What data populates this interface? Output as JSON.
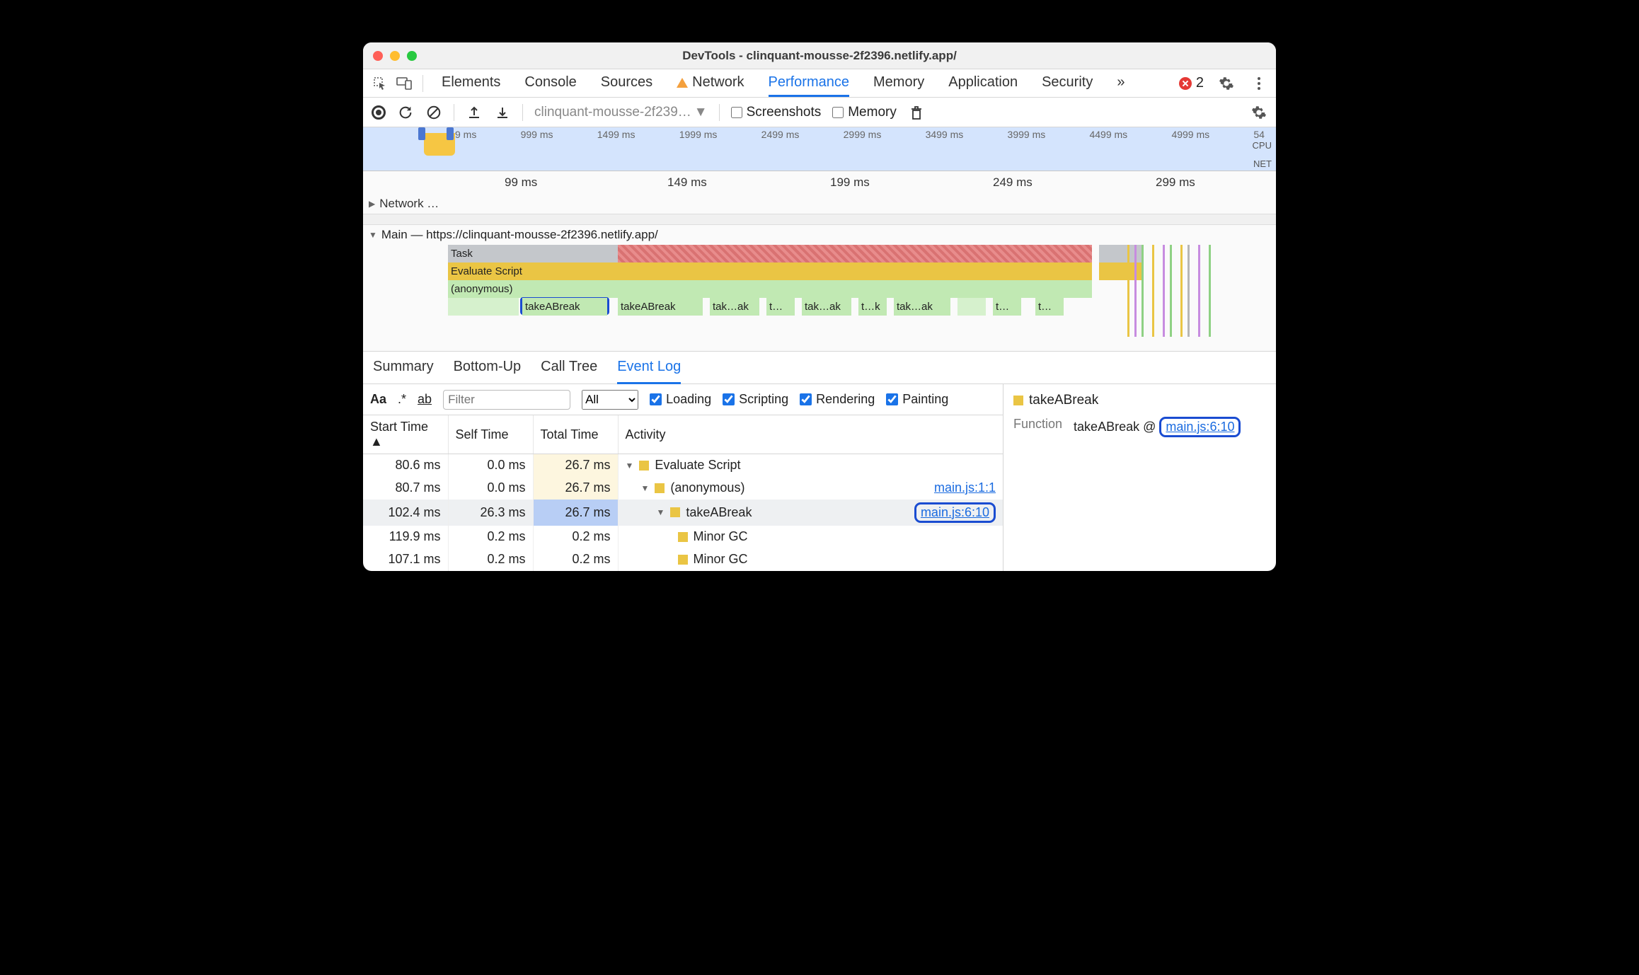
{
  "titlebar": {
    "title": "DevTools - clinquant-mousse-2f2396.netlify.app/"
  },
  "mainTabs": {
    "items": [
      "Elements",
      "Console",
      "Sources",
      "Network",
      "Performance",
      "Memory",
      "Application",
      "Security"
    ],
    "active": "Performance",
    "warnOn": "Network",
    "moreGlyph": "»",
    "errorCount": "2"
  },
  "perfToolbar": {
    "profileLabel": "clinquant-mousse-2f239…",
    "screenshotsLabel": "Screenshots",
    "memoryLabel": "Memory"
  },
  "overview": {
    "ticks": [
      "9 ms",
      "999 ms",
      "1499 ms",
      "1999 ms",
      "2499 ms",
      "2999 ms",
      "3499 ms",
      "3999 ms",
      "4499 ms",
      "4999 ms",
      "54"
    ],
    "cpuLabel": "CPU",
    "netLabel": "NET"
  },
  "timeline": {
    "rulerTicks": [
      "99 ms",
      "149 ms",
      "199 ms",
      "249 ms",
      "299 ms"
    ],
    "networkRow": "Network …",
    "mainHeader": "Main — https://clinquant-mousse-2f2396.netlify.app/",
    "rows": {
      "task": "Task",
      "eval": "Evaluate Script",
      "anon": "(anonymous)",
      "calls": [
        "takeABreak",
        "takeABreak",
        "tak…ak",
        "t…",
        "tak…ak",
        "t…k",
        "tak…ak",
        "t…",
        "t…"
      ]
    }
  },
  "detailsTabs": {
    "items": [
      "Summary",
      "Bottom-Up",
      "Call Tree",
      "Event Log"
    ],
    "active": "Event Log"
  },
  "filter": {
    "aa": "Aa",
    "regex": ".*",
    "ab": "ab",
    "placeholder": "Filter",
    "levelLabel": "All",
    "cats": {
      "loading": "Loading",
      "scripting": "Scripting",
      "rendering": "Rendering",
      "painting": "Painting"
    }
  },
  "table": {
    "headers": {
      "start": "Start Time",
      "self": "Self Time",
      "total": "Total Time",
      "activity": "Activity"
    },
    "rows": [
      {
        "start": "80.6 ms",
        "self": "0.0 ms",
        "total": "26.7 ms",
        "totClass": "tot-bg1",
        "indent": 0,
        "disclose": "▼",
        "sq": "sq-yl",
        "label": "Evaluate Script",
        "link": ""
      },
      {
        "start": "80.7 ms",
        "self": "0.0 ms",
        "total": "26.7 ms",
        "totClass": "tot-bg1",
        "indent": 1,
        "disclose": "▼",
        "sq": "sq-yl",
        "label": "(anonymous)",
        "link": "main.js:1:1"
      },
      {
        "start": "102.4 ms",
        "self": "26.3 ms",
        "total": "26.7 ms",
        "totClass": "tot-bg2",
        "indent": 2,
        "disclose": "▼",
        "sq": "sq-yl",
        "label": "takeABreak",
        "link": "main.js:6:10",
        "ring": true,
        "rowClass": "row-sel"
      },
      {
        "start": "119.9 ms",
        "self": "0.2 ms",
        "total": "0.2 ms",
        "totClass": "",
        "indent": 3,
        "disclose": "",
        "sq": "sq-yl",
        "label": "Minor GC",
        "link": ""
      },
      {
        "start": "107.1 ms",
        "self": "0.2 ms",
        "total": "0.2 ms",
        "totClass": "",
        "indent": 3,
        "disclose": "",
        "sq": "sq-yl",
        "label": "Minor GC",
        "link": ""
      }
    ]
  },
  "side": {
    "title": "takeABreak",
    "funcLabel": "Function",
    "funcName": "takeABreak",
    "at": "@",
    "funcLink": "main.js:6:10"
  }
}
